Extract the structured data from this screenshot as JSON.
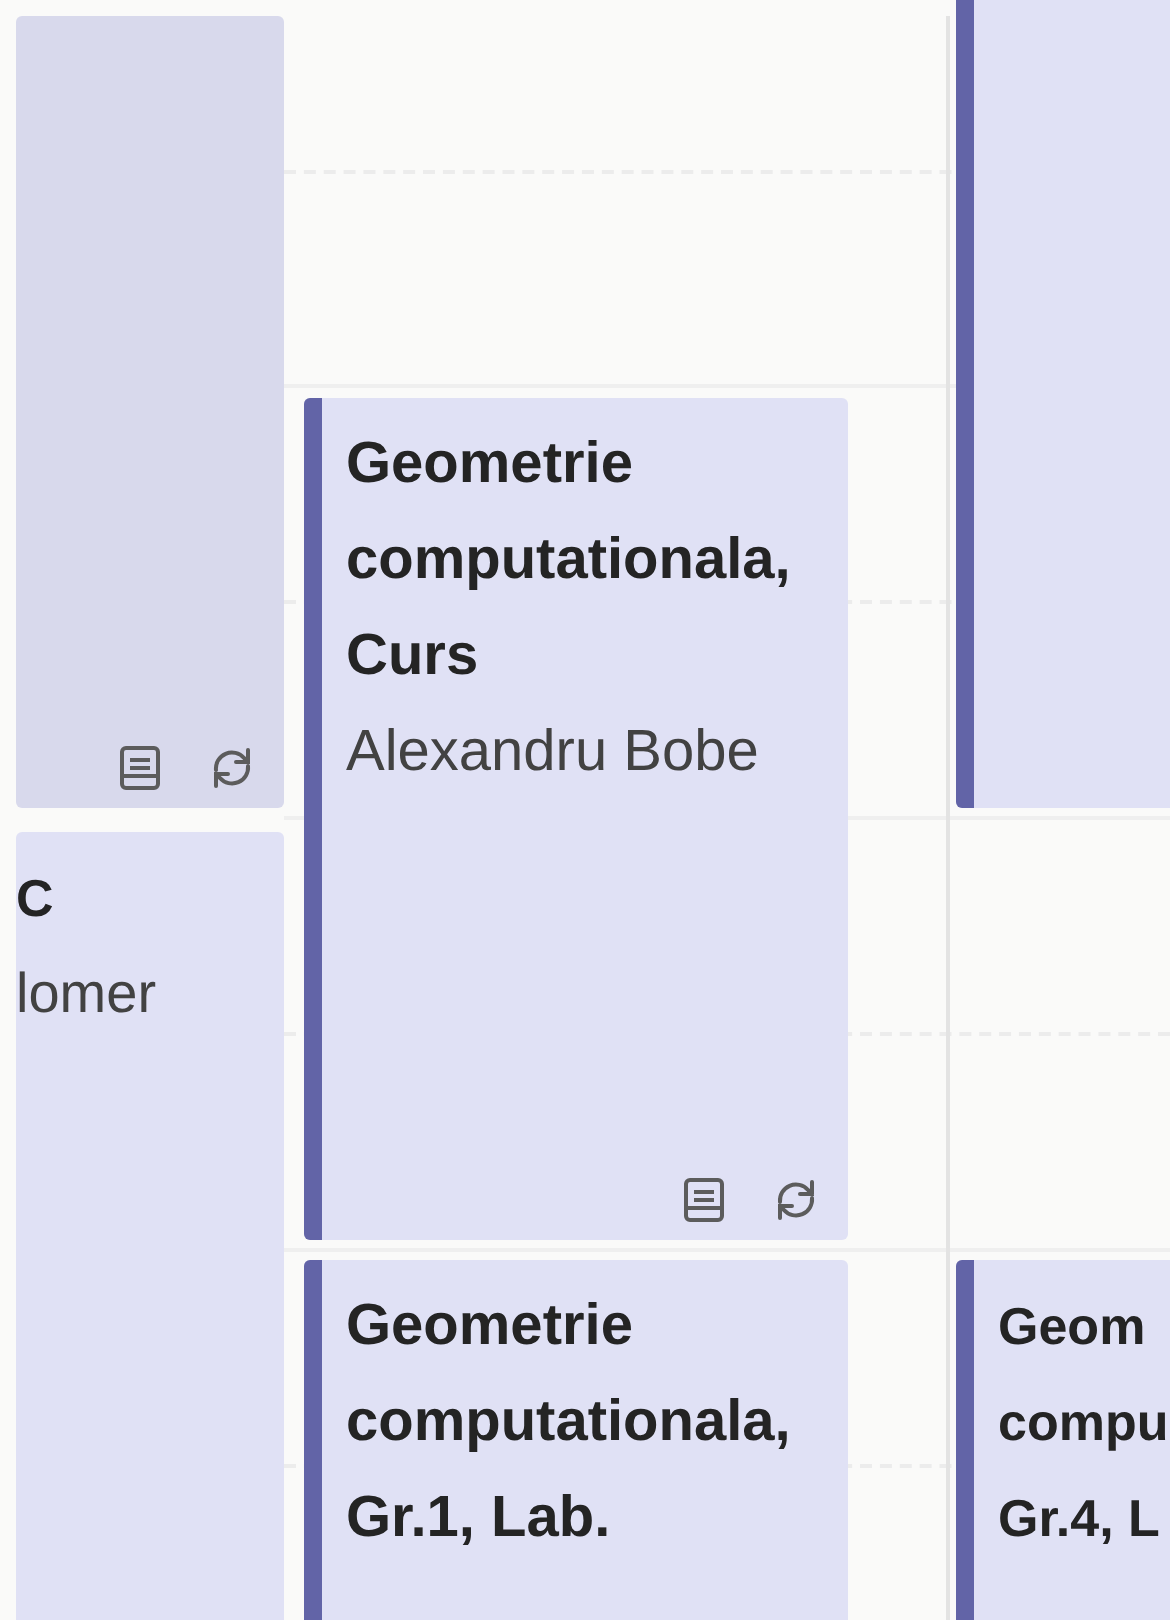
{
  "columns": [
    {
      "events": [
        {
          "kind": "clipped",
          "color": "#d8d9ec",
          "notes": true,
          "recurring": true
        },
        {
          "kind": "clipped",
          "color": "#e0e1f5",
          "title_lines": [
            "C"
          ],
          "organizer": "lomer"
        }
      ]
    },
    {
      "events": [
        {
          "kind": "full",
          "color": "#e0e1f5",
          "title": "Geometrie computationala, Curs",
          "organizer": "Alexandru Bobe",
          "notes": true,
          "recurring": true
        },
        {
          "kind": "full",
          "color": "#e0e1f5",
          "title": "Geometrie computationala, Gr.1, Lab."
        }
      ]
    },
    {
      "events": [
        {
          "kind": "clipped",
          "color": "#e0e1f5"
        },
        {
          "kind": "clipped",
          "color": "#e0e1f5",
          "title_lines": [
            "Geom",
            "compu",
            "Gr.4, L"
          ]
        }
      ]
    }
  ]
}
